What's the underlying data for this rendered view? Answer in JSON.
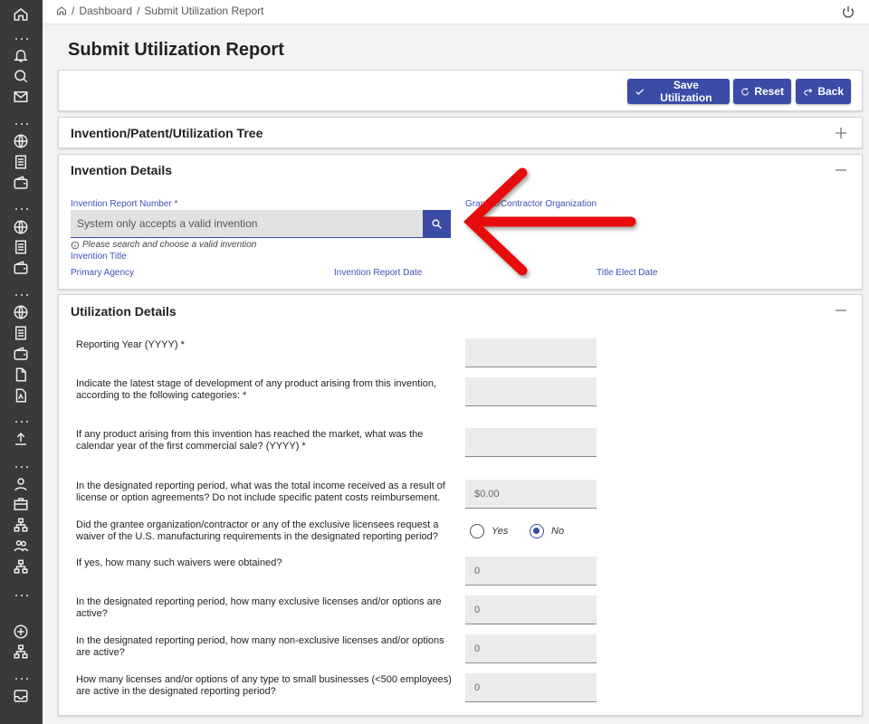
{
  "breadcrumb": {
    "home_icon": "home-icon",
    "sep1": "/",
    "dashboard": "Dashboard",
    "sep2": "/",
    "current": "Submit Utilization Report"
  },
  "page_title": "Submit Utilization Report",
  "toolbar": {
    "save_label": "Save Utilization",
    "reset_label": "Reset",
    "back_label": "Back"
  },
  "tree_panel": {
    "title": "Invention/Patent/Utilization Tree",
    "toggle": "+"
  },
  "invention_details": {
    "title": "Invention Details",
    "report_number_label": "Invention Report Number *",
    "report_number_placeholder": "System only accepts a valid invention",
    "hint": "Please search and choose a valid invention",
    "grantee_label": "Grantee/Contractor Organization",
    "title_label": "Invention Title",
    "primary_agency_label": "Primary Agency",
    "report_date_label": "Invention Report Date",
    "title_elect_label": "Title Elect Date"
  },
  "utilization_details": {
    "title": "Utilization Details",
    "questions": [
      {
        "label": "Reporting Year (YYYY) *",
        "value": ""
      },
      {
        "label": "Indicate the latest stage of development of any product arising from this invention, according to the following categories: *",
        "value": ""
      },
      {
        "label": "If any product arising from this invention has reached the market, what was the calendar year of the first commercial sale? (YYYY)  *",
        "value": ""
      },
      {
        "label": "In the designated reporting period, what was the total income received as a result of license or option agreements? Do not include specific patent costs reimbursement.",
        "value": "$0.00"
      },
      {
        "label": "Did the grantee organization/contractor or any of the exclusive licensees request a waiver of the U.S. manufacturing requirements in the designated reporting period?",
        "value": ""
      },
      {
        "label": "If yes, how many such waivers were obtained?",
        "value": "0"
      },
      {
        "label": "In the designated reporting period, how many exclusive licenses and/or options are active?",
        "value": "0"
      },
      {
        "label": "In the designated reporting period, how many non-exclusive licenses and/or options are active?",
        "value": "0"
      },
      {
        "label": "How many licenses and/or options of any type to small businesses (<500 employees) are active in the designated reporting period?",
        "value": "0"
      }
    ],
    "waiver_options": [
      {
        "label": "Yes",
        "checked": false
      },
      {
        "label": "No",
        "checked": true
      }
    ]
  },
  "colors": {
    "accent": "#3b4ba6",
    "label_blue": "#3f51b5",
    "sidebar": "#3a3a3a",
    "arrow": "#e8100f"
  }
}
